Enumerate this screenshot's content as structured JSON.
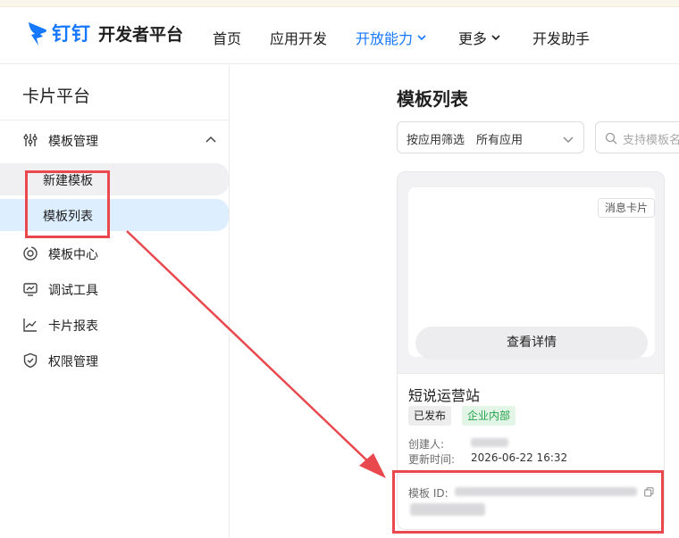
{
  "header": {
    "logo_brand": "钉钉",
    "logo_title": "开发者平台",
    "nav": [
      {
        "label": "首页"
      },
      {
        "label": "应用开发"
      },
      {
        "label": "开放能力"
      },
      {
        "label": "更多"
      },
      {
        "label": "开发助手"
      }
    ],
    "active_color": "#1677ff"
  },
  "sidebar": {
    "title": "卡片平台",
    "group": {
      "label": "模板管理",
      "icon": "sliders-icon"
    },
    "sub_items": [
      {
        "label": "新建模板"
      },
      {
        "label": "模板列表"
      }
    ],
    "items": [
      {
        "label": "模板中心",
        "icon": "template-center-icon"
      },
      {
        "label": "调试工具",
        "icon": "monitor-icon"
      },
      {
        "label": "卡片报表",
        "icon": "chart-line-icon"
      },
      {
        "label": "权限管理",
        "icon": "shield-icon"
      }
    ]
  },
  "main": {
    "title": "模板列表",
    "filter": {
      "label": "按应用筛选",
      "value": "所有应用"
    },
    "search": {
      "placeholder": "支持模板名"
    },
    "card": {
      "tag": "消息卡片",
      "detail_button": "查看详情",
      "name": "短说运营站",
      "badges": [
        "已发布",
        "企业内部"
      ],
      "creator_label": "创建人:",
      "updated_label": "更新时间:",
      "updated_value": "2026-06-22 16:32",
      "id_label": "模板 ID:"
    }
  },
  "annotation_color": "#e8484e"
}
